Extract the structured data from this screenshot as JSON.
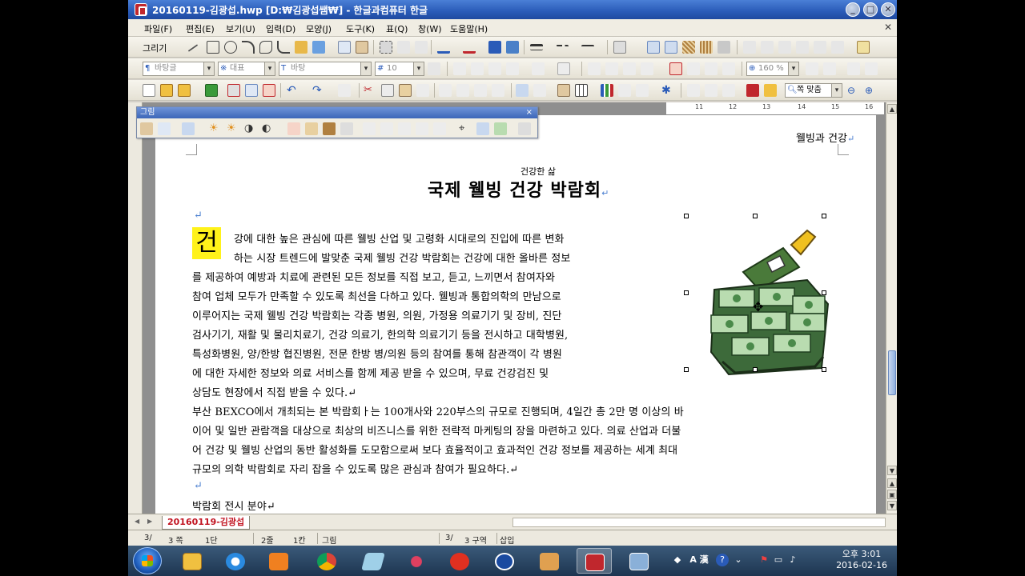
{
  "window": {
    "title": "20160119-김광섭.hwp [D:₩김광섭쌤₩] - 한글과컴퓨터 한글",
    "minimize": "_",
    "maximize": "□",
    "close": "✕"
  },
  "menu": [
    "파일(F)",
    "편집(E)",
    "보기(U)",
    "입력(D)",
    "모양(J)",
    "도구(K)",
    "표(Q)",
    "창(W)",
    "도움말(H)"
  ],
  "menu_close": "✕",
  "toolbar_draw": {
    "label": "그리기"
  },
  "format_bar": {
    "style": "바탕글",
    "lang": "대표",
    "font": "바탕",
    "size": "10",
    "zoom": "160 %"
  },
  "standard_bar": {
    "fit_page": "쪽 맞춤"
  },
  "picture_toolbar": {
    "title": "그림",
    "close": "×"
  },
  "ruler": {
    "ticks": [
      "11",
      "12",
      "13",
      "14",
      "15",
      "16",
      "17",
      "18",
      "19"
    ]
  },
  "document": {
    "header": "웰빙과 건강",
    "ruby": "건강한 삶",
    "title": "국제 웰빙 건강 박람회",
    "para_mark": "↵",
    "dropcap": "건",
    "lines_wrap": [
      "강에 대한 높은 관심에 따른 웰빙 산업 및 고령화 시대로의 진입에 따른 변화",
      "하는 시장 트렌드에 발맞춘 국제 웰빙 건강 박람회는 건강에 대한 올바른 정보",
      "를 제공하여 예방과 치료에 관련된 모든 정보를 직접 보고, 듣고, 느끼면서 참여자와",
      "참여 업체 모두가 만족할 수 있도록 최선을 다하고 있다. 웰빙과 통합의학의 만남으로",
      "이루어지는 국제 웰빙 건강 박람회는 각종 병원, 의원, 가정용 의료기기 및 장비, 진단",
      "검사기기, 재활 및 물리치료기, 건강 의료기, 한의학 의료기기 등을 전시하고 대학병원,",
      "특성화병원, 양/한방 협진병원, 전문 한방 병/의원 등의 참여를 통해 참관객이 각 병원",
      "에 대한 자세한 정보와 의료 서비스를 함께 제공 받을 수 있으며, 무료 건강검진 및",
      "상담도 현장에서 직접 받을 수 있다.↵"
    ],
    "lines_full": [
      "  부산 BEXCO에서 개최되는 본 박람회ㅏ는 100개사와 220부스의 규모로 진행되며, 4일간 총 2만 명 이상의 바",
      "이어 및 일반 관람객을 대상으로 최상의 비즈니스를 위한 전략적 마케팅의 장을 마련하고 있다. 의료 산업과 더불",
      "어 건강 및 웰빙 산업의 동반 활성화를 도모함으로써 보다 효율적이고 효과적인 건강 정보를 제공하는 세계 최대",
      "규모의 의학 박람회로 자리 잡을 수 있도록 많은 관심과 참여가 필요하다.↵"
    ],
    "last_line": "박람회 전시 분야↵"
  },
  "tabs": {
    "active": "20160119-김광섭"
  },
  "statusbar": {
    "cells": [
      "3/",
      "3 쪽",
      "1단",
      "2줄",
      "1칸",
      "그림",
      "3/",
      "3 구역",
      "삽입"
    ]
  },
  "taskbar": {
    "items": [
      "explorer-icon",
      "ie-icon",
      "media-icon",
      "chrome-icon",
      "notepad-icon",
      "capture-icon",
      "app-icon",
      "compass-icon",
      "photo-icon",
      "hwp-icon",
      "window-icon"
    ],
    "tray_lang": "A 漢",
    "time": "오후 3:01",
    "date": "2016-02-16"
  },
  "colors": {
    "titlebar": "#2a5bb8",
    "dropcap_bg": "#fff21a",
    "tab_text": "#c1121f"
  }
}
